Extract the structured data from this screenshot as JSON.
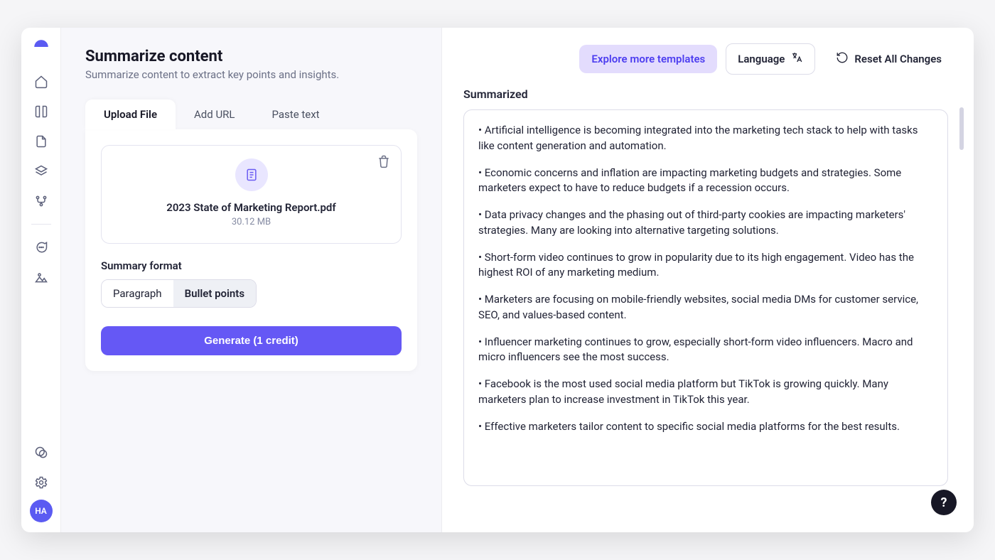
{
  "sidebar": {
    "avatar_initials": "HA"
  },
  "header": {
    "title": "Summarize content",
    "subtitle": "Summarize content to extract key points and insights."
  },
  "tabs": {
    "upload": "Upload File",
    "url": "Add URL",
    "paste": "Paste text"
  },
  "file": {
    "name": "2023 State of Marketing Report.pdf",
    "size": "30.12 MB"
  },
  "format": {
    "label": "Summary format",
    "paragraph": "Paragraph",
    "bullets": "Bullet points"
  },
  "actions": {
    "generate": "Generate (1 credit)"
  },
  "toolbar": {
    "explore": "Explore more templates",
    "language": "Language",
    "reset": "Reset All Changes"
  },
  "output": {
    "title": "Summarized",
    "bullets": [
      "Artificial intelligence is becoming integrated into the marketing tech stack to help with tasks like content generation and automation.",
      "Economic concerns and inflation are impacting marketing budgets and strategies. Some marketers expect to have to reduce budgets if a recession occurs.",
      "Data privacy changes and the phasing out of third-party cookies are impacting marketers' strategies. Many are looking into alternative targeting solutions.",
      "Short-form video continues to grow in popularity due to its high engagement. Video has the highest ROI of any marketing medium.",
      "Marketers are focusing on mobile-friendly websites, social media DMs for customer service, SEO, and values-based content.",
      "Influencer marketing continues to grow, especially short-form video influencers. Macro and micro influencers see the most success.",
      "Facebook is the most used social media platform but TikTok is growing quickly. Many marketers plan to increase investment in TikTok this year.",
      "Effective marketers tailor content to specific social media platforms for the best results."
    ]
  },
  "help": {
    "label": "?"
  }
}
